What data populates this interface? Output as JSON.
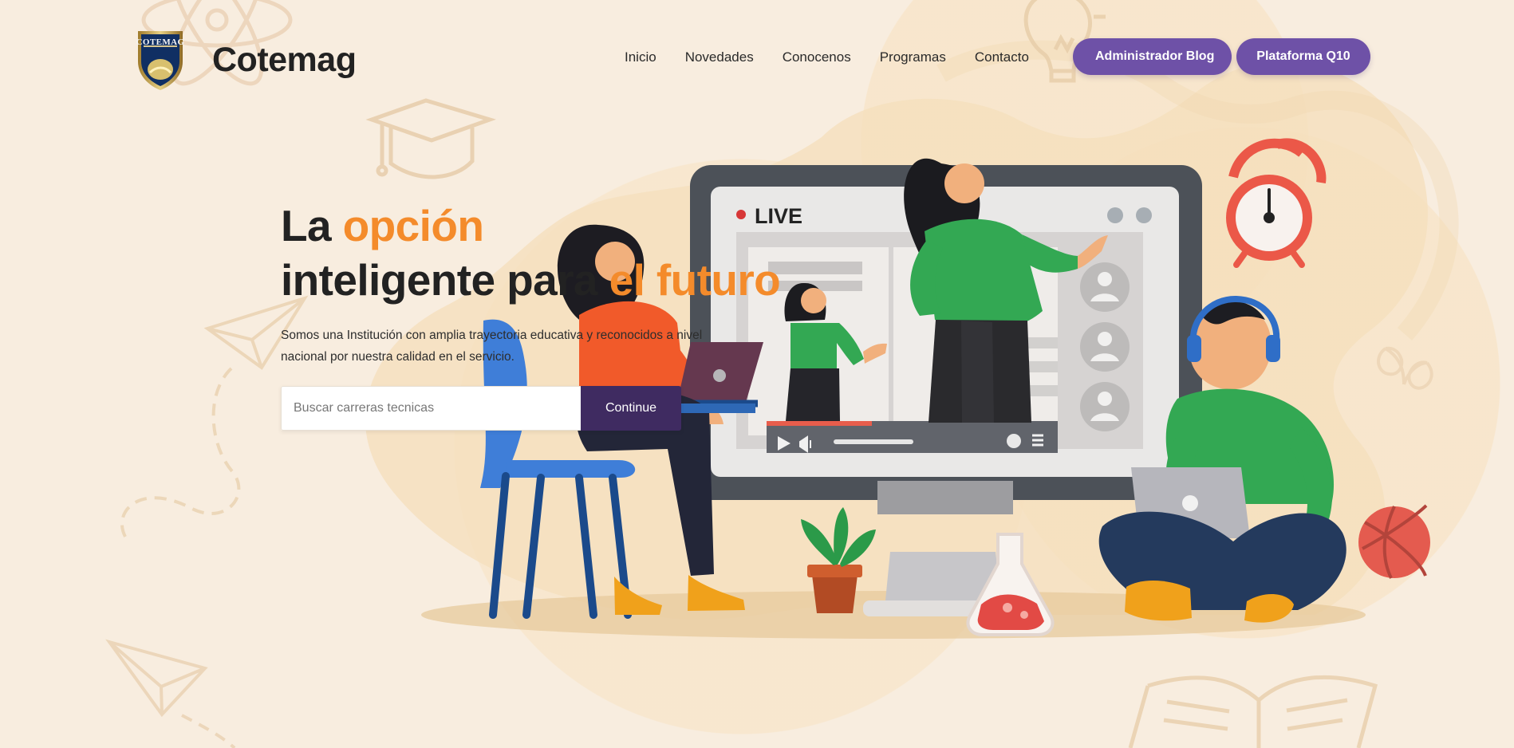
{
  "brand": {
    "logo_text": "COTEMAG",
    "name": "Cotemag"
  },
  "nav": {
    "items": [
      {
        "label": "Inicio"
      },
      {
        "label": "Novedades"
      },
      {
        "label": "Conocenos"
      },
      {
        "label": "Programas"
      },
      {
        "label": "Contacto"
      }
    ]
  },
  "header_buttons": [
    {
      "label": "Administrador Blog"
    },
    {
      "label": "Plataforma Q10"
    }
  ],
  "hero": {
    "title_line1_prefix": "La ",
    "title_line1_accent": "opción",
    "title_line2_prefix": "inteligente para ",
    "title_line2_accent": "el futuro",
    "description": "Somos una Institución con amplia trayectoria educativa y reconocidos a nivel nacional por nuestra calidad en el servicio.",
    "search_placeholder": "Buscar carreras tecnicas",
    "search_value": "",
    "continue_label": "Continue"
  },
  "video_panel": {
    "live_label": "LIVE"
  },
  "colors": {
    "background": "#f8eddf",
    "purple": "#6e51a7",
    "dark_purple": "#3f2b61",
    "accent_orange": "#f48b2b"
  },
  "icons": [
    "graduation-cap-icon",
    "paper-plane-icon",
    "lightbulb-icon",
    "alarm-clock-icon",
    "basketball-icon",
    "book-icon",
    "laptop-icon",
    "chair-icon",
    "flask-icon",
    "plant-icon",
    "avatar-icon",
    "play-icon",
    "volume-icon",
    "settings-icon",
    "fullscreen-icon"
  ]
}
